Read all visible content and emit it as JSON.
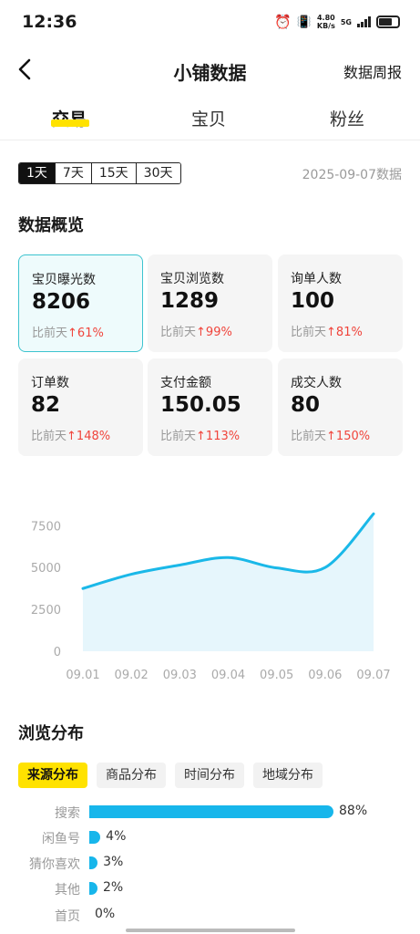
{
  "status_bar": {
    "time": "12:36",
    "speed_value": "4.80",
    "speed_unit": "KB/s",
    "network": "5G"
  },
  "header": {
    "title": "小铺数据",
    "weekly_report": "数据周报"
  },
  "tabs": [
    {
      "label": "交易",
      "active": true
    },
    {
      "label": "宝贝",
      "active": false
    },
    {
      "label": "粉丝",
      "active": false
    }
  ],
  "ranges": [
    {
      "label": "1天",
      "active": true
    },
    {
      "label": "7天",
      "active": false
    },
    {
      "label": "15天",
      "active": false
    },
    {
      "label": "30天",
      "active": false
    }
  ],
  "date_label": "2025-09-07数据",
  "overview_title": "数据概览",
  "compare_prefix": "比前天",
  "metrics": [
    {
      "label": "宝贝曝光数",
      "value": "8206",
      "delta": "61%",
      "selected": true
    },
    {
      "label": "宝贝浏览数",
      "value": "1289",
      "delta": "99%"
    },
    {
      "label": "询单人数",
      "value": "100",
      "delta": "81%"
    },
    {
      "label": "订单数",
      "value": "82",
      "delta": "148%"
    },
    {
      "label": "支付金额",
      "value": "150.05",
      "delta": "113%"
    },
    {
      "label": "成交人数",
      "value": "80",
      "delta": "150%"
    }
  ],
  "chart_data": {
    "type": "area",
    "categories": [
      "09.01",
      "09.02",
      "09.03",
      "09.04",
      "09.05",
      "09.06",
      "09.07"
    ],
    "series": [
      {
        "values": [
          3750,
          4600,
          5150,
          5600,
          4980,
          5000,
          8206
        ]
      }
    ],
    "yticks": [
      "0",
      "2500",
      "5000",
      "7500"
    ],
    "ylim": [
      0,
      8500
    ],
    "colors": {
      "line": "#1ab8e8",
      "fill": "#e6f6fc"
    },
    "grid": false
  },
  "browse_title": "浏览分布",
  "dist_tabs": [
    {
      "label": "来源分布",
      "active": true
    },
    {
      "label": "商品分布",
      "active": false
    },
    {
      "label": "时间分布",
      "active": false
    },
    {
      "label": "地域分布",
      "active": false
    }
  ],
  "sources": [
    {
      "label": "搜索",
      "pct": 88,
      "pct_label": "88%"
    },
    {
      "label": "闲鱼号",
      "pct": 4,
      "pct_label": "4%"
    },
    {
      "label": "猜你喜欢",
      "pct": 3,
      "pct_label": "3%"
    },
    {
      "label": "其他",
      "pct": 2,
      "pct_label": "2%"
    },
    {
      "label": "首页",
      "pct": 0,
      "pct_label": "0%"
    }
  ],
  "colors": {
    "accent_yellow": "#ffe200",
    "up_red": "#f0443b",
    "bar_blue": "#17b6eb",
    "selected_border": "#3cc3cf"
  }
}
